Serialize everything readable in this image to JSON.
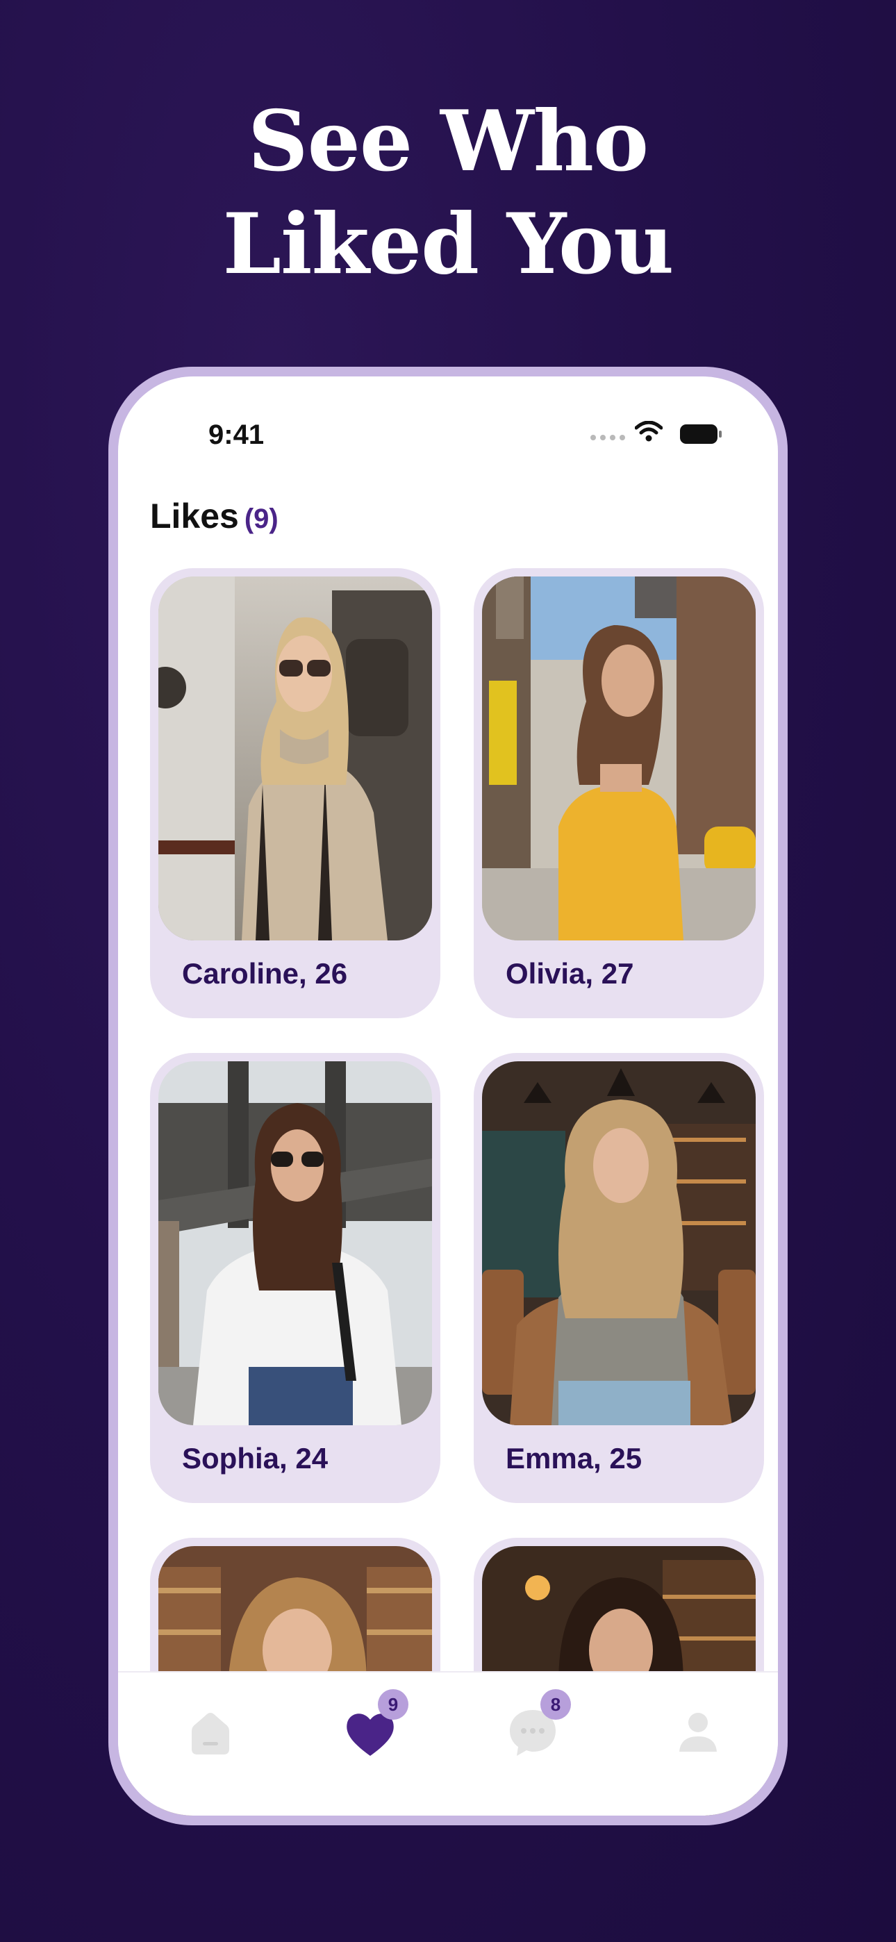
{
  "headline": {
    "line1": "See Who",
    "line2": "Liked You"
  },
  "status_bar": {
    "time": "9:41"
  },
  "likes": {
    "title": "Likes",
    "count": "(9)"
  },
  "profiles": [
    {
      "name": "Caroline, 26"
    },
    {
      "name": "Olivia, 27"
    },
    {
      "name": "Sophia, 24"
    },
    {
      "name": "Emma, 25"
    },
    {
      "name": ""
    },
    {
      "name": ""
    }
  ],
  "tab_bar": {
    "items": [
      {
        "icon": "home-icon"
      },
      {
        "icon": "heart-icon",
        "badge": "9"
      },
      {
        "icon": "chat-icon",
        "badge": "8"
      },
      {
        "icon": "profile-icon"
      }
    ]
  },
  "colors": {
    "background": "#23104a",
    "phone_frame": "#c7b6e2",
    "accent_purple": "#4a2488",
    "card_bg": "#e8e0f1",
    "badge_bg": "#b79fdb"
  }
}
